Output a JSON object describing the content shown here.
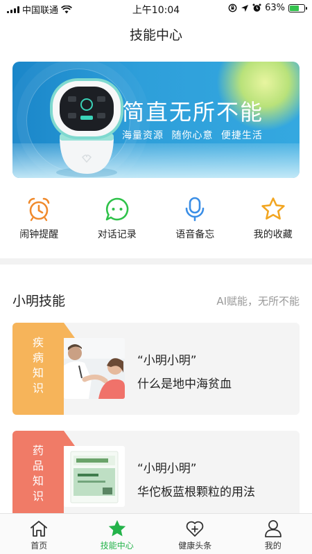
{
  "status_bar": {
    "carrier": "中国联通",
    "time": "上午10:04",
    "battery_percent": "63%",
    "battery_level": 0.63,
    "icons": [
      "signal-icon",
      "wifi-icon",
      "rotation-lock-icon",
      "location-icon",
      "alarm-icon",
      "battery-icon"
    ]
  },
  "header": {
    "title": "技能中心"
  },
  "banner": {
    "title": "简直无所不能",
    "subtitle": "海量资源  随你心意  便捷生活"
  },
  "quick_actions": [
    {
      "label": "闹钟提醒",
      "icon": "alarm-clock-icon",
      "color": "#f08a2c"
    },
    {
      "label": "对话记录",
      "icon": "chat-bubble-icon",
      "color": "#2fc24a"
    },
    {
      "label": "语音备忘",
      "icon": "microphone-icon",
      "color": "#3a8ee6"
    },
    {
      "label": "我的收藏",
      "icon": "star-icon",
      "color": "#f2a622"
    }
  ],
  "section": {
    "title": "小明技能",
    "slogan": "AI赋能，无所不能"
  },
  "cards": [
    {
      "tag": "疾病知识",
      "line1": "“小明小明”",
      "line2": "什么是地中海贫血",
      "tag_color": "#f6b45a"
    },
    {
      "tag": "药品知识",
      "line1": "“小明小明”",
      "line2": "华佗板蓝根颗粒的用法",
      "tag_color": "#f07b67"
    }
  ],
  "tabbar": {
    "active_color": "#24b34a",
    "items": [
      {
        "label": "首页",
        "icon": "home-icon",
        "active": false
      },
      {
        "label": "技能中心",
        "icon": "star-icon",
        "active": true
      },
      {
        "label": "健康头条",
        "icon": "heart-plus-icon",
        "active": false
      },
      {
        "label": "我的",
        "icon": "person-icon",
        "active": false
      }
    ]
  }
}
